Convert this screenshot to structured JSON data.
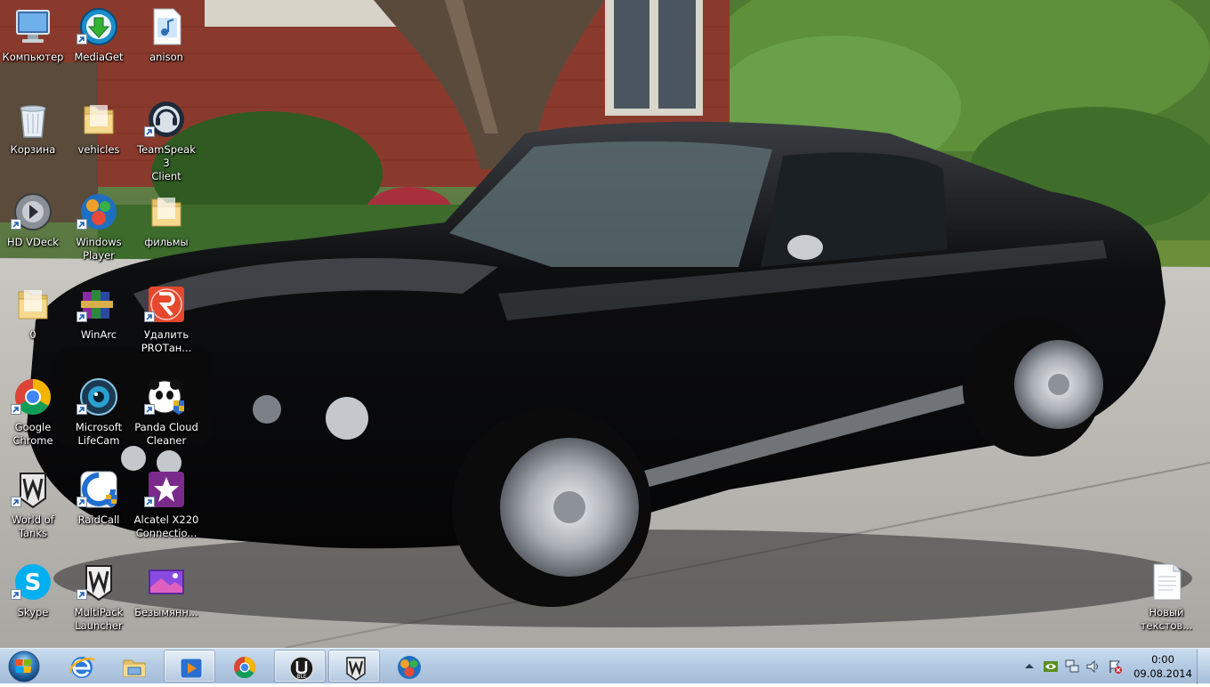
{
  "desktop": {
    "icons": [
      {
        "label": "Компьютер",
        "icon": "computer-icon"
      },
      {
        "label": "MediaGet",
        "icon": "mediaget-icon"
      },
      {
        "label": "anison",
        "icon": "audio-file-icon"
      },
      {
        "label": "Корзина",
        "icon": "recycle-bin-icon"
      },
      {
        "label": "vehicles",
        "icon": "folder-icon"
      },
      {
        "label": "TeamSpeak 3\nClient",
        "icon": "teamspeak-icon"
      },
      {
        "label": "HD VDeck",
        "icon": "hd-vdeck-icon"
      },
      {
        "label": "Windows\nPlayer",
        "icon": "windows-player-icon"
      },
      {
        "label": "фильмы",
        "icon": "folder-icon"
      },
      {
        "label": "0",
        "icon": "folder-icon"
      },
      {
        "label": "WinArc",
        "icon": "winarc-icon"
      },
      {
        "label": "Удалить\nPROTан...",
        "icon": "uninstall-icon"
      },
      {
        "label": "Google\nChrome",
        "icon": "chrome-icon"
      },
      {
        "label": "Microsoft\nLifeCam",
        "icon": "lifecam-icon"
      },
      {
        "label": "Panda Cloud\nCleaner",
        "icon": "panda-icon"
      },
      {
        "label": "World of\nTanks",
        "icon": "world-of-tanks-icon"
      },
      {
        "label": "RaidCall",
        "icon": "raidcall-icon"
      },
      {
        "label": "Alcatel X220\nConnectio...",
        "icon": "alcatel-icon"
      },
      {
        "label": "Skype",
        "icon": "skype-icon"
      },
      {
        "label": "MultiPack\nLauncher",
        "icon": "multipack-icon"
      },
      {
        "label": "Безымянн...",
        "icon": "image-file-icon"
      },
      {
        "label": "Новый\nтекстов...",
        "icon": "text-file-icon"
      }
    ]
  },
  "taskbar": {
    "pinned": [
      {
        "name": "internet-explorer",
        "icon": "ie-icon",
        "open": false
      },
      {
        "name": "windows-explorer",
        "icon": "explorer-icon",
        "open": false
      },
      {
        "name": "media-player",
        "icon": "media-player-icon",
        "open": true
      },
      {
        "name": "google-chrome",
        "icon": "chrome-icon",
        "open": false
      },
      {
        "name": "ublock-app",
        "icon": "shield-app-icon",
        "open": true
      },
      {
        "name": "world-of-tanks",
        "icon": "world-of-tanks-icon",
        "open": true
      },
      {
        "name": "windows-player",
        "icon": "windows-player-icon",
        "open": false
      }
    ]
  },
  "clock": {
    "time": "0:00",
    "date": "09.08.2014"
  },
  "colors": {
    "accent": "#2b6cc4",
    "taskbar": "#b4cbe3"
  }
}
